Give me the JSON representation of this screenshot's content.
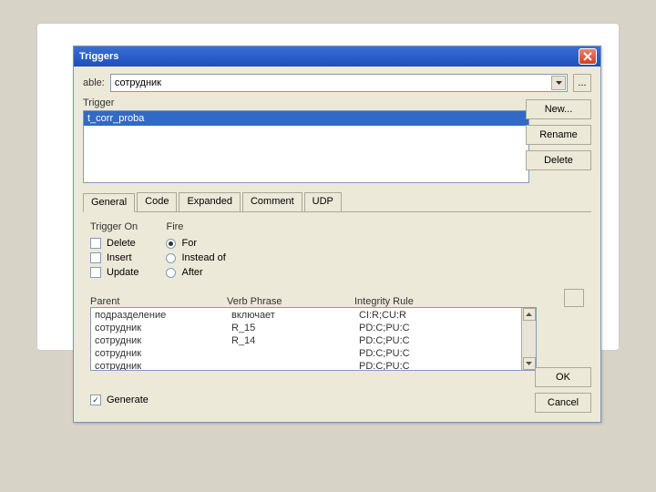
{
  "titlebar": {
    "title": "Triggers"
  },
  "tableRow": {
    "label": "able:",
    "value": "сотрудник",
    "ellipsis": "..."
  },
  "triggerSection": {
    "label": "Trigger"
  },
  "triggerList": {
    "items": [
      "t_corr_proba"
    ]
  },
  "sideButtons": {
    "new": "New...",
    "rename": "Rename",
    "delete": "Delete"
  },
  "tabs": {
    "items": [
      "General",
      "Code",
      "Expanded",
      "Comment",
      "UDP"
    ],
    "active": 0
  },
  "triggerOn": {
    "title": "Trigger On",
    "options": [
      {
        "label": "Delete",
        "checked": false
      },
      {
        "label": "Insert",
        "checked": false
      },
      {
        "label": "Update",
        "checked": false
      }
    ]
  },
  "fire": {
    "title": "Fire",
    "options": [
      {
        "label": "For",
        "checked": true
      },
      {
        "label": "Instead of",
        "checked": false
      },
      {
        "label": "After",
        "checked": false
      }
    ]
  },
  "gridHeaders": {
    "parent": "Parent",
    "verb": "Verb Phrase",
    "rule": "Integrity Rule"
  },
  "gridRows": [
    {
      "parent": "подразделение",
      "verb": "включает",
      "rule": "CI:R;CU:R"
    },
    {
      "parent": "сотрудник",
      "verb": "R_15",
      "rule": "PD:C;PU:C"
    },
    {
      "parent": "сотрудник",
      "verb": "R_14",
      "rule": "PD:C;PU:C"
    },
    {
      "parent": "сотрудник",
      "verb": "",
      "rule": "PD:C;PU:C"
    },
    {
      "parent": "сотрудник",
      "verb": "",
      "rule": "PD:C;PU:C"
    }
  ],
  "generate": {
    "label": "Generate",
    "checked": true
  },
  "bottomButtons": {
    "ok": "OK",
    "cancel": "Cancel"
  }
}
